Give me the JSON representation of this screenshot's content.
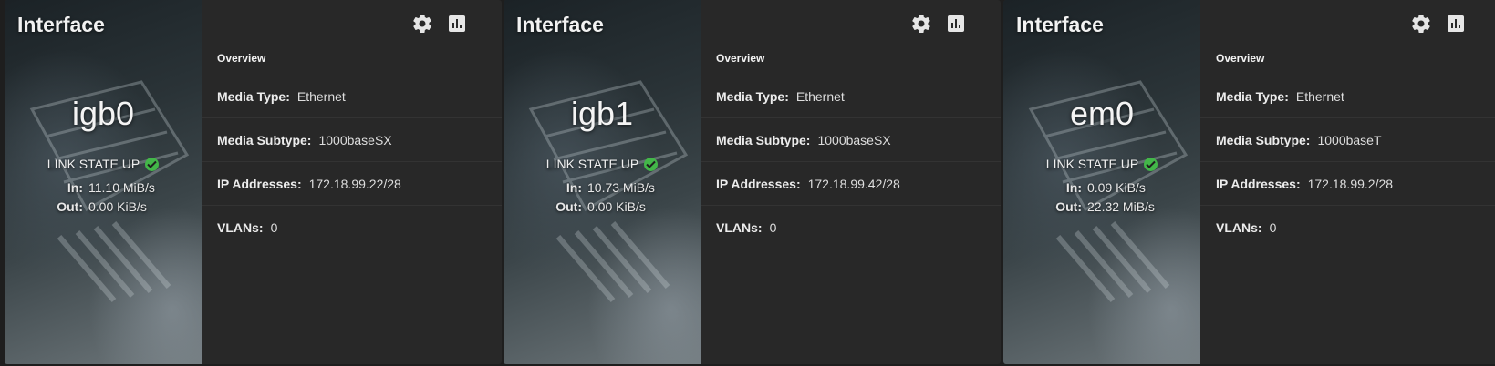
{
  "cards": [
    {
      "title": "Interface",
      "name": "igb0",
      "link_state": "LINK STATE UP",
      "in_label": "In:",
      "in_value": "11.10 MiB/s",
      "out_label": "Out:",
      "out_value": "0.00 KiB/s",
      "section": "Overview",
      "media_type_label": "Media Type:",
      "media_type": "Ethernet",
      "media_subtype_label": "Media Subtype:",
      "media_subtype": "1000baseSX",
      "ip_label": "IP Addresses:",
      "ip": "172.18.99.22/28",
      "vlans_label": "VLANs:",
      "vlans": "0"
    },
    {
      "title": "Interface",
      "name": "igb1",
      "link_state": "LINK STATE UP",
      "in_label": "In:",
      "in_value": "10.73 MiB/s",
      "out_label": "Out:",
      "out_value": "0.00 KiB/s",
      "section": "Overview",
      "media_type_label": "Media Type:",
      "media_type": "Ethernet",
      "media_subtype_label": "Media Subtype:",
      "media_subtype": "1000baseSX",
      "ip_label": "IP Addresses:",
      "ip": "172.18.99.42/28",
      "vlans_label": "VLANs:",
      "vlans": "0"
    },
    {
      "title": "Interface",
      "name": "em0",
      "link_state": "LINK STATE UP",
      "in_label": "In:",
      "in_value": "0.09 KiB/s",
      "out_label": "Out:",
      "out_value": "22.32 MiB/s",
      "section": "Overview",
      "media_type_label": "Media Type:",
      "media_type": "Ethernet",
      "media_subtype_label": "Media Subtype:",
      "media_subtype": "1000baseT",
      "ip_label": "IP Addresses:",
      "ip": "172.18.99.2/28",
      "vlans_label": "VLANs:",
      "vlans": "0"
    }
  ],
  "icons": {
    "settings": "gear-icon",
    "stats": "bar-chart-icon",
    "link_up": "check-circle-icon"
  },
  "colors": {
    "card_bg": "#282828",
    "page_bg": "#1e1e1e",
    "link_up": "#43b749",
    "text": "#e8e8e8"
  }
}
